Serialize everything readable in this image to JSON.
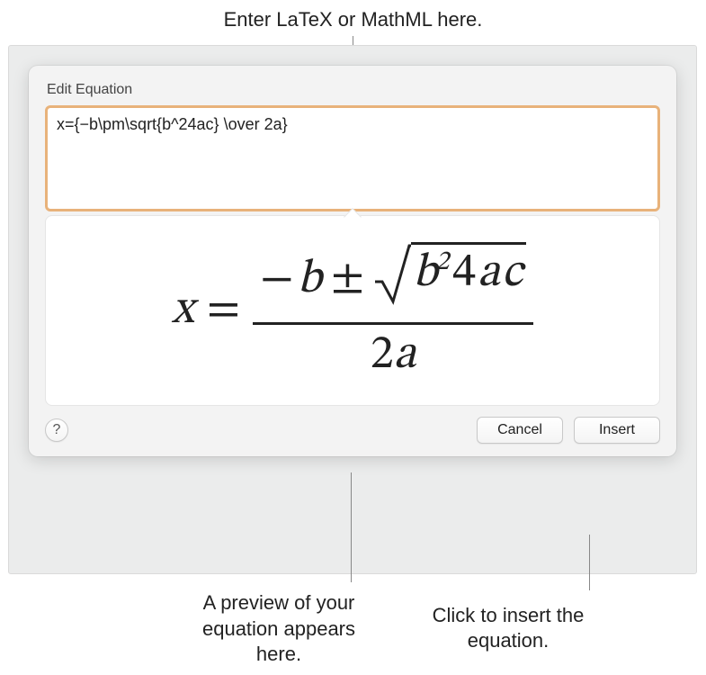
{
  "callouts": {
    "top": "Enter LaTeX or MathML here.",
    "bottom_left": "A preview of your equation appears here.",
    "bottom_right": "Click to insert the equation."
  },
  "dialog": {
    "title": "Edit Equation",
    "input_value": "x={−b\\pm\\sqrt{b^24ac} \\over 2a}",
    "cancel_label": "Cancel",
    "insert_label": "Insert",
    "help_label": "?"
  },
  "equation": {
    "lhs": "x",
    "equals": "=",
    "minus": "−",
    "b": "b",
    "pm": "±",
    "sup2": "2",
    "four": "4",
    "a": "a",
    "c": "c",
    "den_two": "2",
    "den_a": "a"
  }
}
